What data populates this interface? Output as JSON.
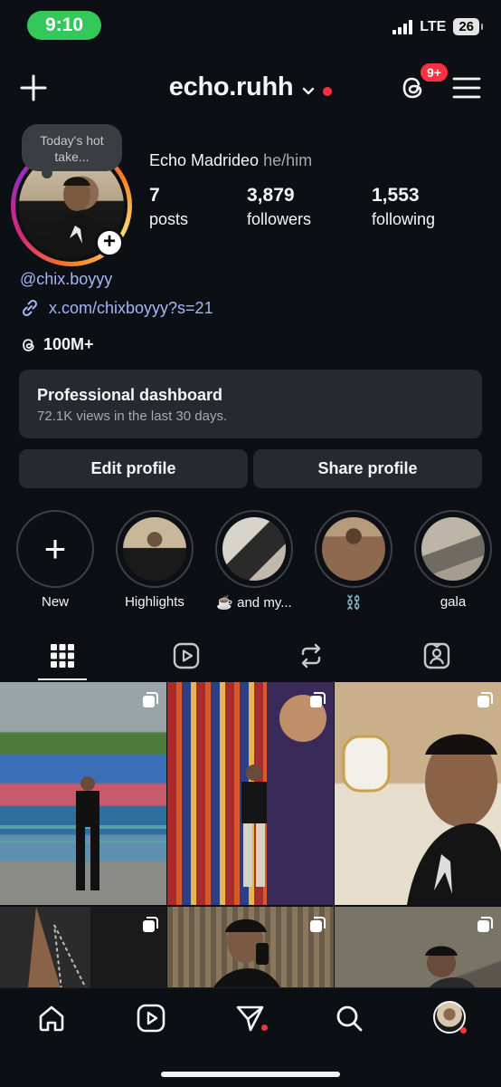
{
  "status": {
    "time": "9:10",
    "network": "LTE",
    "battery": "26"
  },
  "header": {
    "username": "echo.ruhh",
    "notification_count": "9+"
  },
  "profile": {
    "note": "Today's hot take...",
    "full_name": "Echo Madrideo",
    "pronouns": "he/him",
    "stats": [
      {
        "value": "7",
        "label": "posts"
      },
      {
        "value": "3,879",
        "label": "followers"
      },
      {
        "value": "1,553",
        "label": "following"
      }
    ],
    "handle": "@chix.boyyy",
    "link": "x.com/chixboyyy?s=21",
    "threads_followers": "100M+"
  },
  "dashboard": {
    "title": "Professional dashboard",
    "subtitle": "72.1K views in the last 30 days."
  },
  "buttons": {
    "edit": "Edit profile",
    "share": "Share profile"
  },
  "highlights": [
    {
      "label": "New"
    },
    {
      "label": "Highlights"
    },
    {
      "label": "☕️ and my..."
    },
    {
      "label": "⛓️"
    },
    {
      "label": "gala"
    }
  ],
  "colors": {
    "accent_link": "#a6b5f5",
    "badge_red": "#ff3040",
    "background": "#0c1014"
  }
}
